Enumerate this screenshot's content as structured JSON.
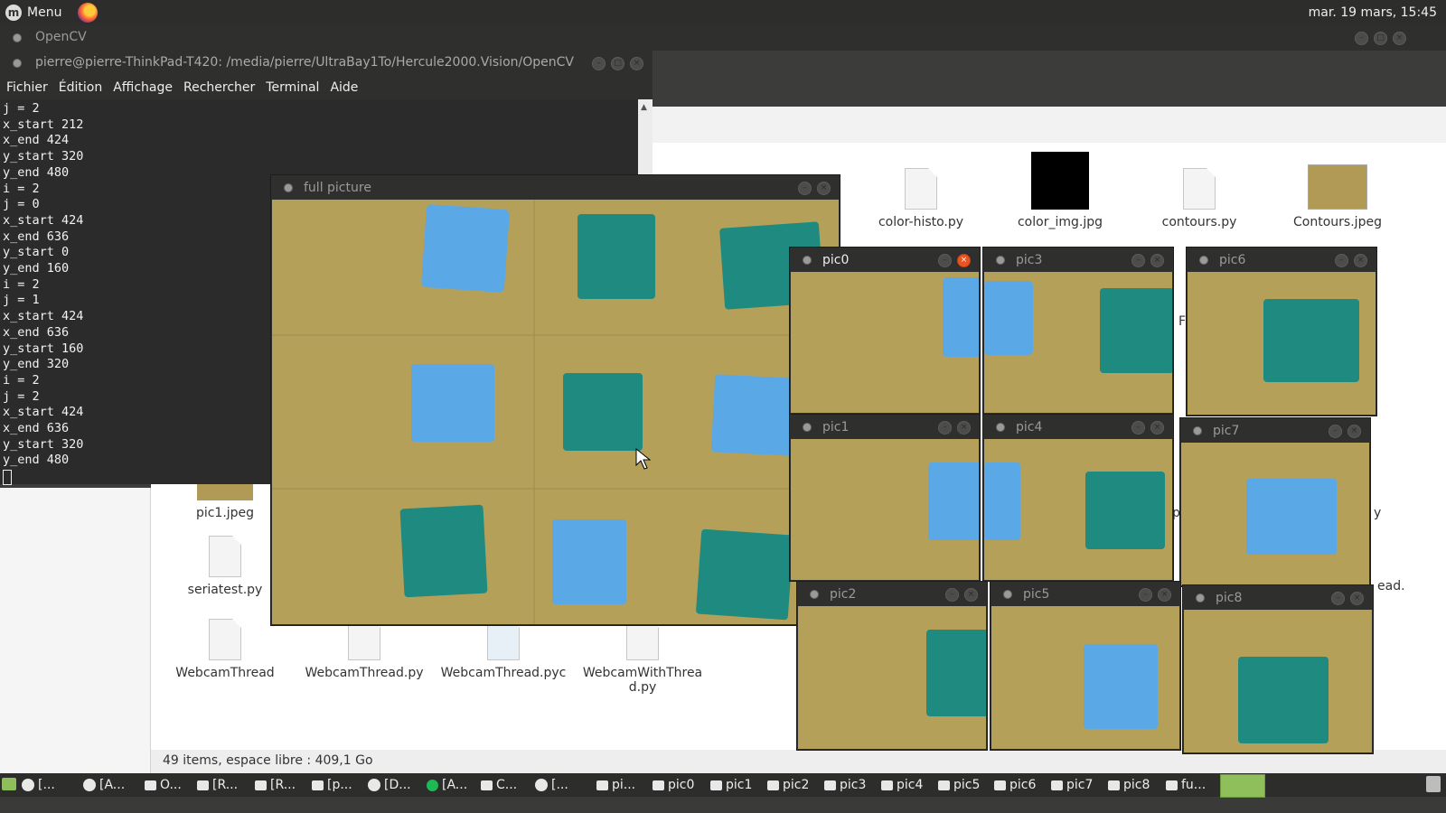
{
  "top_panel": {
    "menu_label": "Menu",
    "clock": "mar. 19 mars, 15:45"
  },
  "opencv_window": {
    "title": "OpenCV"
  },
  "terminal": {
    "title": "pierre@pierre-ThinkPad-T420: /media/pierre/UltraBay1To/Hercule2000.Vision/OpenCV",
    "menu": [
      "Fichier",
      "Édition",
      "Affichage",
      "Rechercher",
      "Terminal",
      "Aide"
    ],
    "lines": [
      "j = 2",
      "x_start 212",
      "x_end 424",
      "y_start 320",
      "y_end 480",
      "i = 2",
      "j = 0",
      "x_start 424",
      "x_end 636",
      "y_start 0",
      "y_end 160",
      "i = 2",
      "j = 1",
      "x_start 424",
      "x_end 636",
      "y_start 160",
      "y_end 320",
      "i = 2",
      "j = 2",
      "x_start 424",
      "x_end 636",
      "y_start 320",
      "y_end 480"
    ]
  },
  "file_manager": {
    "files": [
      "color-histo.py",
      "color_img.jpg",
      "contours.py",
      "Contours.jpeg",
      "pic1.jpeg",
      "seriatest.py",
      "WebcamThread",
      "WebcamThread.py",
      "WebcamThread.pyc",
      "WebcamWithThread.py"
    ],
    "fragments": [
      "F",
      "p",
      "y",
      "ead."
    ],
    "status": "49 items, espace libre : 409,1 Go"
  },
  "windows": {
    "full": "full picture",
    "pic0": "pic0",
    "pic1": "pic1",
    "pic2": "pic2",
    "pic3": "pic3",
    "pic4": "pic4",
    "pic5": "pic5",
    "pic6": "pic6",
    "pic7": "pic7",
    "pic8": "pic8"
  },
  "taskbar": {
    "items": [
      "[...",
      "[A...",
      "O...",
      "[R...",
      "[R...",
      "[p...",
      "[D...",
      "[A...",
      "C...",
      "[...",
      "pi...",
      "pic0",
      "pic1",
      "pic2",
      "pic3",
      "pic4",
      "pic5",
      "pic6",
      "pic7",
      "pic8",
      "fu..."
    ]
  },
  "colors": {
    "board": "#b09a55",
    "blue_cube": "#5aa8e6",
    "teal_cube": "#1f8a80",
    "accent": "#e95420"
  }
}
